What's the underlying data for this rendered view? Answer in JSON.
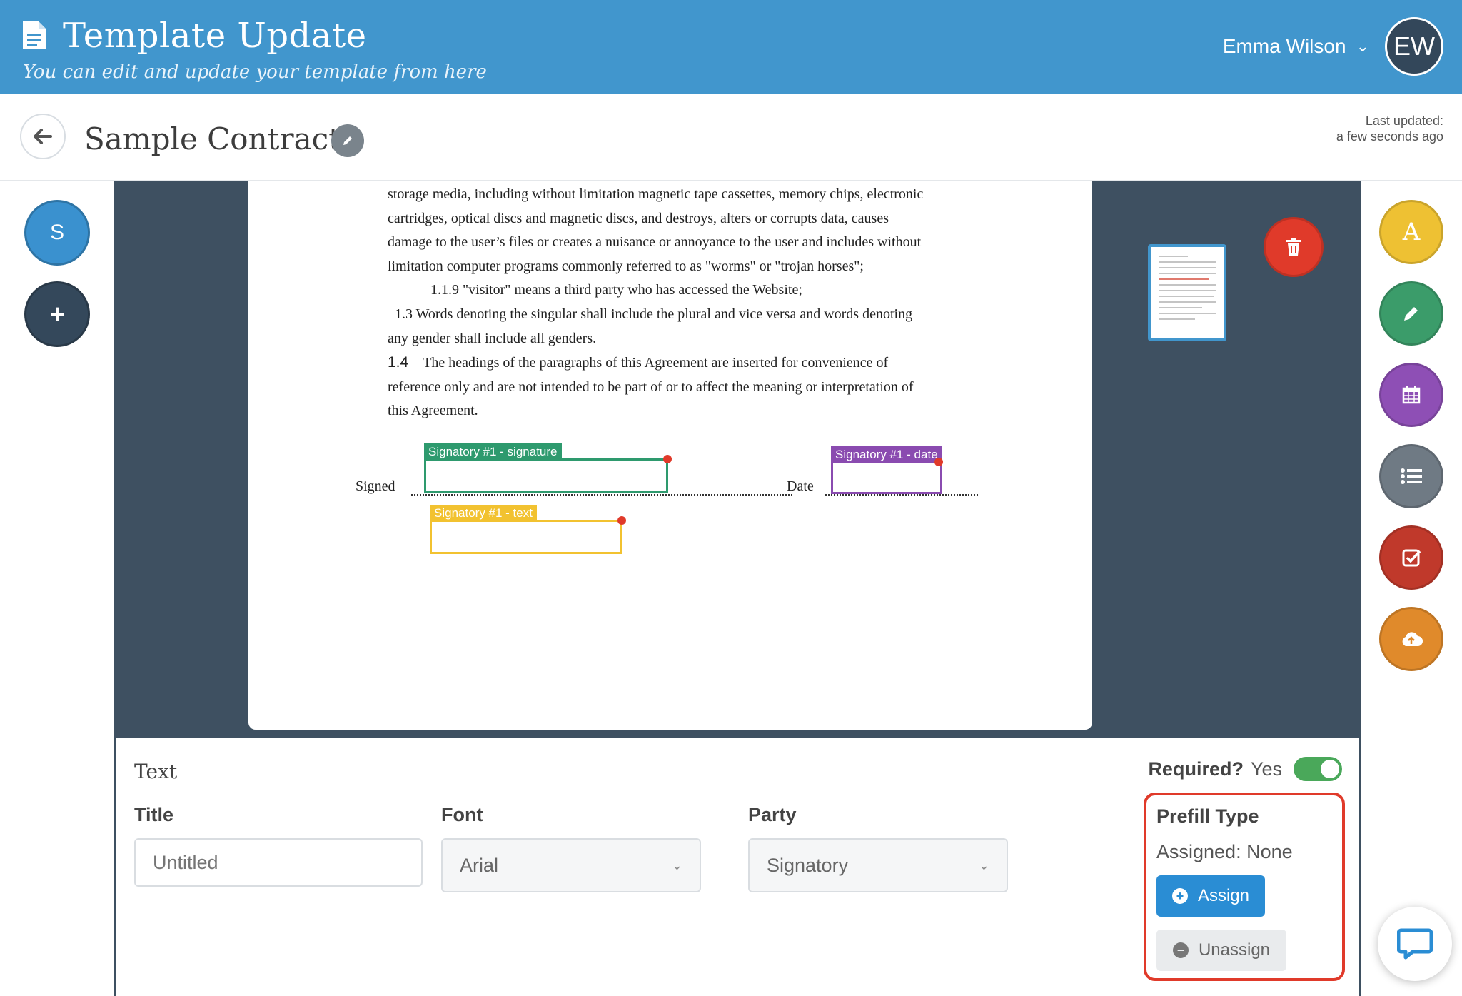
{
  "header": {
    "title": "Template Update",
    "subtitle": "You can edit and update your template from here",
    "user_name": "Emma Wilson",
    "avatar_initials": "EW",
    "color": "#4196cd"
  },
  "subheader": {
    "page_title": "Sample Contract",
    "last_updated_label": "Last updated:",
    "last_updated_value": "a few seconds ago"
  },
  "left_rail": {
    "signatory_initial": "S",
    "add_label": "+"
  },
  "document": {
    "lines": [
      "storage media, including without limitation magnetic tape cassettes, memory chips, electronic",
      "cartridges, optical discs and magnetic discs, and destroys, alters or corrupts data, causes",
      "damage to the user’s files or creates a nuisance or annoyance to the user and includes without",
      "limitation computer programs commonly referred to as \"worms\" or \"trojan horses\";",
      "1.1.9 \"visitor\" means a third party who has accessed the Website;",
      "1.3 Words denoting the singular shall include the plural and vice versa and words denoting",
      "any gender shall include all genders.",
      "The headings of the paragraphs of this Agreement are inserted for convenience of",
      "reference only and are not intended to be part of or to affect the meaning or interpretation of",
      "this Agreement."
    ],
    "section_number": "1.4",
    "signed_label": "Signed",
    "date_label": "Date",
    "fields": {
      "signature": "Signatory #1 - signature",
      "text": "Signatory #1 - text",
      "date": "Signatory #1 - date"
    },
    "field_colors": {
      "signature": "#2e9a6e",
      "text": "#f2c230",
      "date": "#8a4bb0"
    }
  },
  "right_rail": {
    "text_tool_letter": "A",
    "tools": [
      "text-tool",
      "signature-tool",
      "date-tool",
      "list-tool",
      "checkbox-tool",
      "upload-tool"
    ],
    "colors": [
      "#eec133",
      "#3b9c6a",
      "#8e4fb5",
      "#6f7a84",
      "#c0392b",
      "#e08a2b"
    ]
  },
  "panel": {
    "heading": "Text",
    "title_label": "Title",
    "title_placeholder": "Untitled",
    "font_label": "Font",
    "font_value": "Arial",
    "party_label": "Party",
    "party_value": "Signatory",
    "required_label": "Required?",
    "required_value": "Yes",
    "prefill_title": "Prefill Type",
    "assigned_text": "Assigned: None",
    "assign_label": "Assign",
    "unassign_label": "Unassign"
  }
}
